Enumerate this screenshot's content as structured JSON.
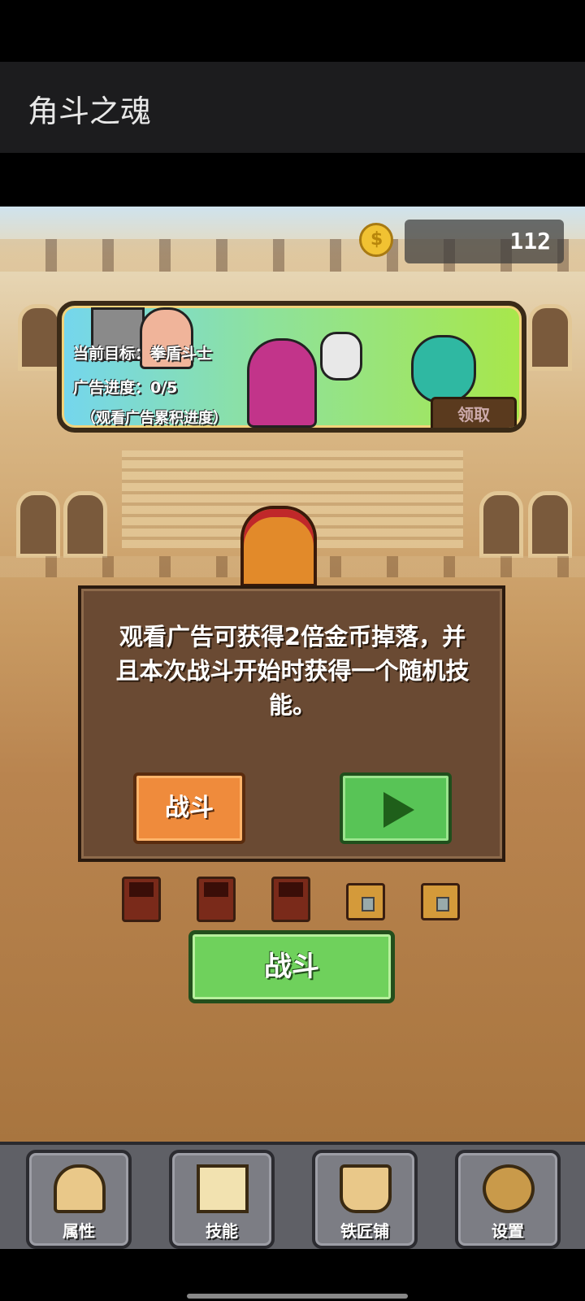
{
  "app": {
    "title": "角斗之魂"
  },
  "currency": {
    "coins": "112",
    "coin_icon": "gold-coin-icon"
  },
  "banner": {
    "target_line": "当前目标：拳盾斗士",
    "progress_line": "广告进度：0/5",
    "hint_line": "（观看广告累积进度）",
    "claim_label": "领取"
  },
  "dialog": {
    "message": "观看广告可获得2倍金币掉落，并且本次战斗开始时获得一个随机技能。",
    "fight_label": "战斗",
    "play_icon": "play-icon"
  },
  "chests": [
    {
      "type": "red",
      "icon": "chest-icon"
    },
    {
      "type": "red",
      "icon": "chest-icon"
    },
    {
      "type": "red",
      "icon": "chest-icon"
    },
    {
      "type": "gold",
      "icon": "chest-icon"
    },
    {
      "type": "gold",
      "icon": "chest-icon"
    }
  ],
  "main_button": {
    "label": "战斗"
  },
  "nav": {
    "items": [
      {
        "label": "属性",
        "icon": "helmet-icon"
      },
      {
        "label": "技能",
        "icon": "book-icon"
      },
      {
        "label": "铁匠铺",
        "icon": "anvil-icon"
      },
      {
        "label": "设置",
        "icon": "gear-icon"
      }
    ]
  },
  "colors": {
    "fight_orange": "#ef8b3c",
    "play_green": "#58c456",
    "main_green": "#6fd15c"
  }
}
